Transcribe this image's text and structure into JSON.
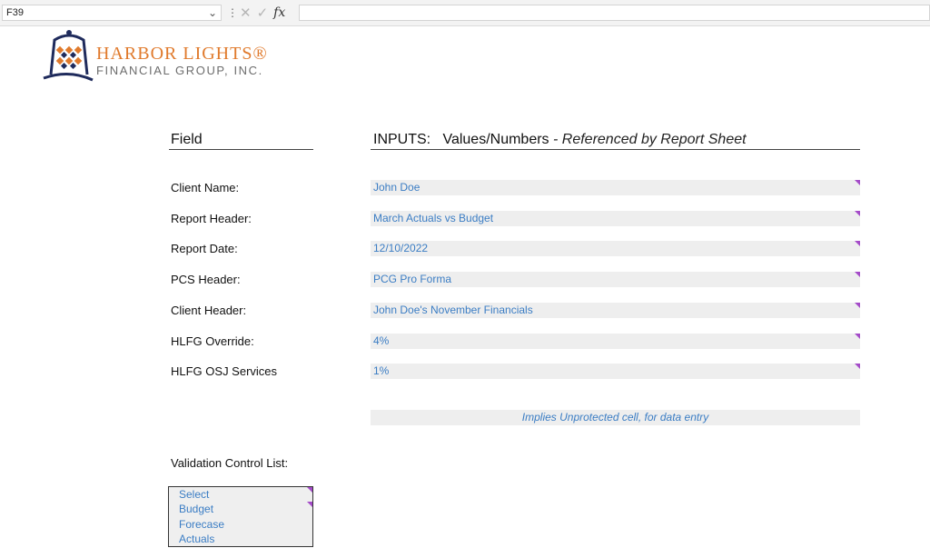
{
  "formula_bar": {
    "cell_ref": "F39",
    "fx_label": "fx",
    "formula_value": ""
  },
  "logo": {
    "line1": "HARBOR LIGHTS®",
    "line2": "FINANCIAL GROUP, INC."
  },
  "headers": {
    "field": "Field",
    "inputs": "INPUTS:",
    "values": "Values/Numbers",
    "referenced": " - Referenced by Report Sheet"
  },
  "rows": [
    {
      "label": "Client Name:",
      "value": "John Doe"
    },
    {
      "label": "Report Header:",
      "value": "March Actuals vs Budget"
    },
    {
      "label": "Report Date:",
      "value": "12/10/2022"
    },
    {
      "label": "PCS Header:",
      "value": "PCG Pro Forma"
    },
    {
      "label": "Client Header:",
      "value": "John Doe's November Financials"
    },
    {
      "label": "HLFG Override:",
      "value": "4%"
    },
    {
      "label": "HLFG OSJ Services",
      "value": "1%"
    }
  ],
  "note": "Implies Unprotected cell, for data entry",
  "validation": {
    "label": "Validation Control List:",
    "items": [
      "Select",
      "Budget",
      "Forecase",
      "Actuals"
    ]
  },
  "colors": {
    "value_text": "#3b7dc4",
    "cell_fill": "#eeeeee",
    "marker": "#a44bc8",
    "logo_orange": "#e07a2c"
  }
}
